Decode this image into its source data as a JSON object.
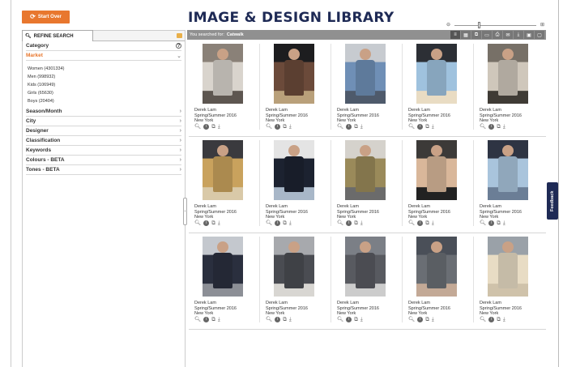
{
  "header": {
    "start_over_label": "Start Over",
    "page_title": "IMAGE & DESIGN LIBRARY",
    "brand_color": "#1e2a55",
    "accent_color": "#e8772e",
    "zoom_level": 0.3
  },
  "sidebar": {
    "tab_label": "REFINE SEARCH",
    "sections": [
      {
        "label": "Category",
        "icon": "help-icon"
      },
      {
        "label": "Market",
        "icon": "chevron-down-icon",
        "expanded": true
      },
      {
        "label": "Season/Month",
        "icon": "chevron-right-icon"
      },
      {
        "label": "City",
        "icon": "chevron-right-icon"
      },
      {
        "label": "Designer",
        "icon": "chevron-right-icon"
      },
      {
        "label": "Classification",
        "icon": "chevron-right-icon"
      },
      {
        "label": "Keywords",
        "icon": "chevron-right-icon"
      },
      {
        "label": "Colours - BETA",
        "icon": "chevron-right-icon"
      },
      {
        "label": "Tones - BETA",
        "icon": "chevron-right-icon"
      }
    ],
    "market_options": [
      "Women (4301334)",
      "Men (998932)",
      "Kids (106949)",
      "Girls (65630)",
      "Boys (20404)"
    ]
  },
  "results": {
    "search_prefix": "You searched for:",
    "search_term": "Catwalk",
    "items": [
      {
        "designer": "Derek Lam",
        "season": "Spring/Summer 2016",
        "city": "New York"
      },
      {
        "designer": "Derek Lam",
        "season": "Spring/Summer 2016",
        "city": "New York"
      },
      {
        "designer": "Derek Lam",
        "season": "Spring/Summer 2016",
        "city": "New York"
      },
      {
        "designer": "Derek Lam",
        "season": "Spring/Summer 2016",
        "city": "New York"
      },
      {
        "designer": "Derek Lam",
        "season": "Spring/Summer 2016",
        "city": "New York"
      },
      {
        "designer": "Derek Lam",
        "season": "Spring/Summer 2016",
        "city": "New York"
      },
      {
        "designer": "Derek Lam",
        "season": "Spring/Summer 2016",
        "city": "New York"
      },
      {
        "designer": "Derek Lam",
        "season": "Spring/Summer 2016",
        "city": "New York"
      },
      {
        "designer": "Derek Lam",
        "season": "Spring/Summer 2016",
        "city": "New York"
      },
      {
        "designer": "Derek Lam",
        "season": "Spring/Summer 2016",
        "city": "New York"
      },
      {
        "designer": "Derek Lam",
        "season": "Spring/Summer 2016",
        "city": "New York"
      },
      {
        "designer": "Derek Lam",
        "season": "Spring/Summer 2016",
        "city": "New York"
      },
      {
        "designer": "Derek Lam",
        "season": "Spring/Summer 2016",
        "city": "New York"
      },
      {
        "designer": "Derek Lam",
        "season": "Spring/Summer 2016",
        "city": "New York"
      },
      {
        "designer": "Derek Lam",
        "season": "Spring/Summer 2016",
        "city": "New York"
      }
    ]
  },
  "feedback_label": "Feedback"
}
